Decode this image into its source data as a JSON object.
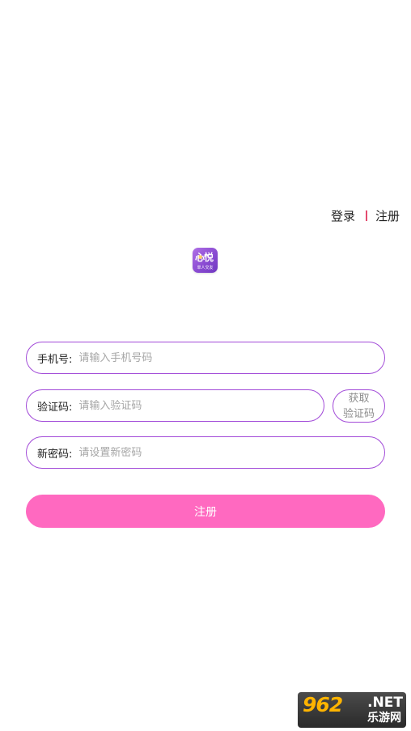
{
  "nav": {
    "login": "登录",
    "register": "注册"
  },
  "logo": {
    "title": "心悦",
    "subtitle": "单人交友"
  },
  "form": {
    "phone": {
      "label": "手机号:",
      "placeholder": "请输入手机号码"
    },
    "code": {
      "label": "验证码:",
      "placeholder": "请输入验证码"
    },
    "get_code": {
      "line1": "获取",
      "line2": "验证码"
    },
    "password": {
      "label": "新密码:",
      "placeholder": "请设置新密码"
    },
    "submit": "注册"
  },
  "watermark": {
    "number": "962",
    "domain": ".NET",
    "cn": "乐游网"
  },
  "colors": {
    "border": "#a24bd8",
    "submit_bg": "#ff69c0",
    "separator": "#e34a6e"
  }
}
